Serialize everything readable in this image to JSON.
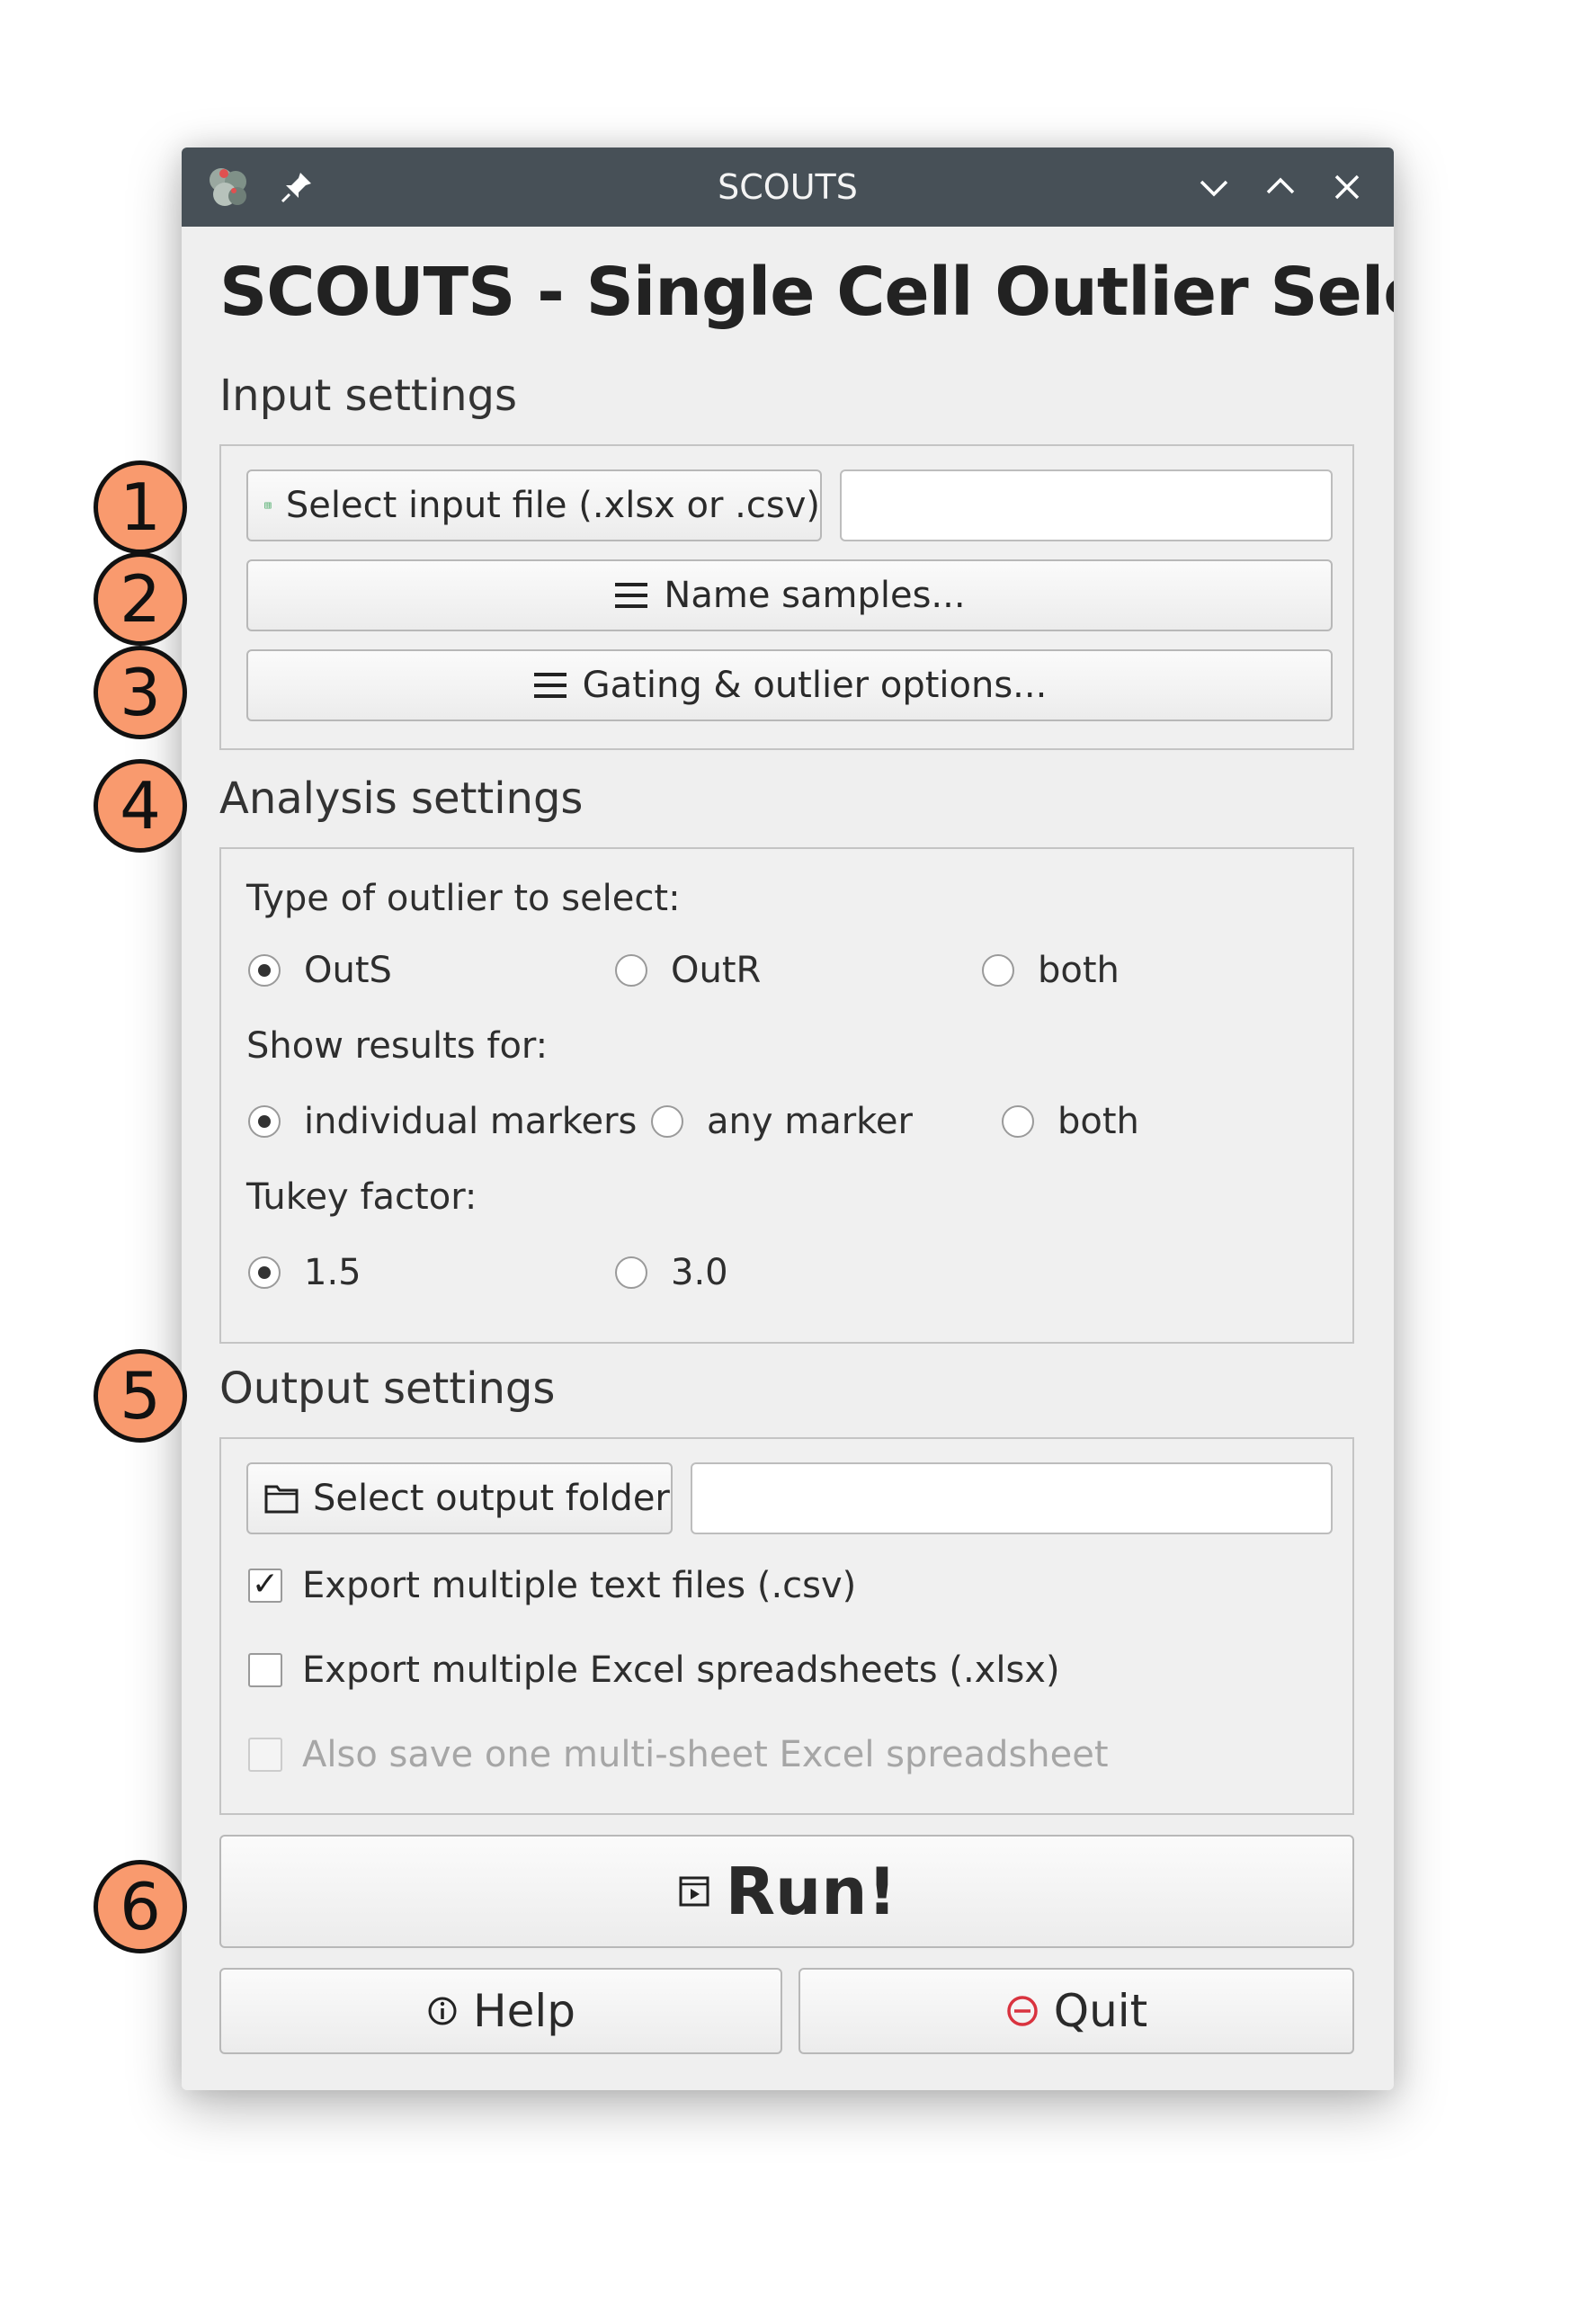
{
  "window": {
    "title": "SCOUTS",
    "heading": "SCOUTS - Single Cell Outlier Selector"
  },
  "input_settings": {
    "label": "Input settings",
    "select_file_label": "Select input file (.xlsx or .csv)",
    "file_path_value": "",
    "name_samples_label": "Name samples...",
    "gating_label": "Gating & outlier options..."
  },
  "analysis_settings": {
    "label": "Analysis settings",
    "outlier_type_label": "Type of outlier to select:",
    "outlier_type_options": [
      "OutS",
      "OutR",
      "both"
    ],
    "outlier_type_selected": "OutS",
    "show_results_label": "Show results for:",
    "show_results_options": [
      "individual markers",
      "any marker",
      "both"
    ],
    "show_results_selected": "individual markers",
    "tukey_label": "Tukey factor:",
    "tukey_options": [
      "1.5",
      "3.0"
    ],
    "tukey_selected": "1.5"
  },
  "output_settings": {
    "label": "Output settings",
    "select_folder_label": "Select output folder",
    "folder_path_value": "",
    "export_csv_label": "Export multiple text files (.csv)",
    "export_csv_checked": true,
    "export_xlsx_label": "Export multiple Excel spreadsheets (.xlsx)",
    "export_xlsx_checked": false,
    "multi_sheet_label": "Also save one multi-sheet Excel spreadsheet",
    "multi_sheet_checked": false,
    "multi_sheet_enabled": false
  },
  "actions": {
    "run_label": "Run!",
    "help_label": "Help",
    "quit_label": "Quit"
  },
  "markers": [
    "1",
    "2",
    "3",
    "4",
    "5",
    "6"
  ],
  "colors": {
    "titlebar": "#475057",
    "marker_fill": "#f99a6e",
    "spreadsheet_icon": "#3aa35a",
    "quit_icon": "#d9333f"
  }
}
